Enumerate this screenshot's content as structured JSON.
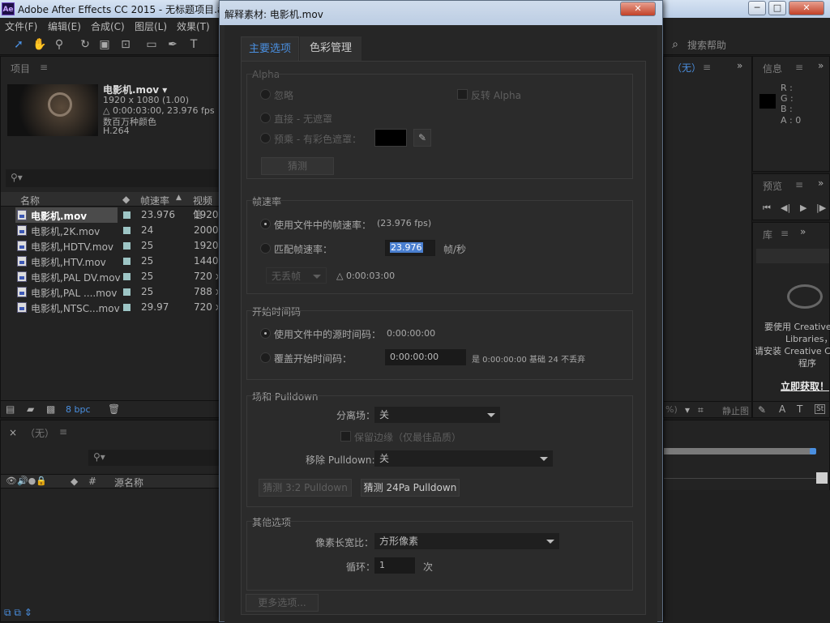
{
  "window": {
    "title": "Adobe After Effects CC 2015 - 无标题项目.aep",
    "app_icon": "Ae"
  },
  "menu": [
    "文件(F)",
    "编辑(E)",
    "合成(C)",
    "图层(L)",
    "效果(T)"
  ],
  "search_help": "搜索帮助",
  "project": {
    "panel_title": "项目",
    "selected": {
      "name": "电影机.mov ▾",
      "res": "1920 x 1080 (1.00)",
      "dur": "△ 0:00:03:00, 23.976 fps",
      "colors": "数百万种颜色",
      "codec": "H.264"
    },
    "col_name": "名称",
    "col_fps": "帧速率",
    "col_video": "视频信",
    "items": [
      {
        "name": "电影机.mov",
        "fps": "23.976",
        "video": "1920 x"
      },
      {
        "name": "电影机,2K.mov",
        "fps": "24",
        "video": "2000 x"
      },
      {
        "name": "电影机,HDTV.mov",
        "fps": "25",
        "video": "1920 x"
      },
      {
        "name": "电影机,HTV.mov",
        "fps": "25",
        "video": "1440 x"
      },
      {
        "name": "电影机,PAL DV.mov",
        "fps": "25",
        "video": "720 x"
      },
      {
        "name": "电影机,PAL ....mov",
        "fps": "25",
        "video": "788 x"
      },
      {
        "name": "电影机,NTSC...mov",
        "fps": "29.97",
        "video": "720 x"
      }
    ],
    "bpc": "8 bpc"
  },
  "timeline": {
    "tab": "（无）",
    "col_source": "源名称",
    "col_hash": "#"
  },
  "info": {
    "title": "信息",
    "r": "R :",
    "g": "G :",
    "b": "B :",
    "a": "A : 0"
  },
  "preview": {
    "title": "预览"
  },
  "library": {
    "title": "库",
    "msg1": "要使用 Creative",
    "msg2": "Libraries，",
    "msg3": "请安装 Creative Clo",
    "msg4": "程序",
    "link": "立即获取！"
  },
  "comp_tab": "（无）",
  "comp_bottom": {
    "zoom": "%)",
    "label": "静止图"
  },
  "dialog": {
    "title": "解释素材: 电影机.mov",
    "tabs": [
      "主要选项",
      "色彩管理"
    ],
    "alpha": {
      "title": "Alpha",
      "ignore": "忽略",
      "invert": "反转  Alpha",
      "straight": "直接 - 无遮罩",
      "premult": "预乘 - 有彩色遮罩：",
      "guess": "猜测"
    },
    "framerate": {
      "title": "帧速率",
      "use_file": "使用文件中的帧速率：",
      "file_fps": "(23.976 fps)",
      "conform": "匹配帧速率：",
      "value": "23.976",
      "unit": "帧/秒",
      "dropframe": "无丢帧",
      "duration": "△ 0:00:03:00"
    },
    "timecode": {
      "title": "开始时间码",
      "use_file": "使用文件中的源时间码：",
      "file_tc": "0:00:00:00",
      "override": "覆盖开始时间码：",
      "value": "0:00:00:00",
      "info": "是 0:00:00:00  基础 24  不丢弃"
    },
    "fields": {
      "title": "场和 Pulldown",
      "separate": "分离场：",
      "separate_val": "关",
      "preserve": "保留边缘（仅最佳品质）",
      "remove": "移除 Pulldown:",
      "remove_val": "关",
      "guess32": "猜测 3:2 Pulldown",
      "guess24": "猜测 24Pa Pulldown"
    },
    "other": {
      "title": "其他选项",
      "par": "像素长宽比：",
      "par_val": "方形像素",
      "loop": "循环：",
      "loop_val": "1",
      "loop_unit": "次",
      "more": "更多选项..."
    }
  }
}
